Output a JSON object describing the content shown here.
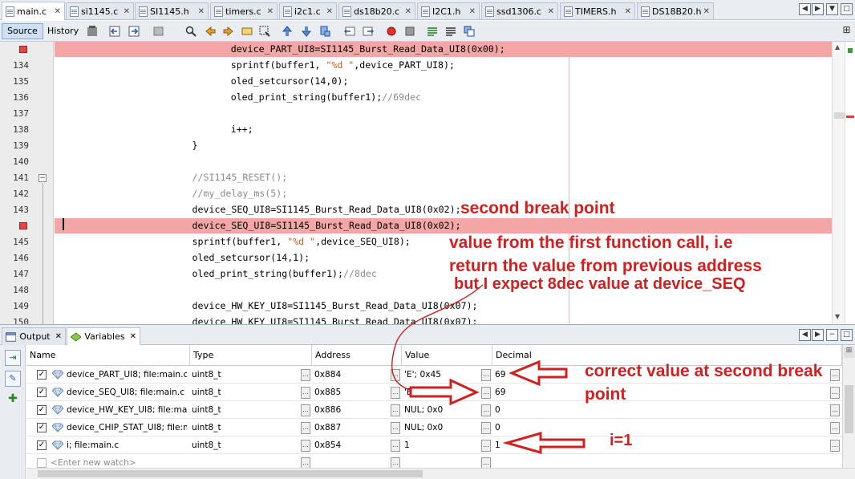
{
  "file_tabs": [
    {
      "name": "main.c",
      "active": true
    },
    {
      "name": "si1145.c",
      "active": false
    },
    {
      "name": "SI1145.h",
      "active": false
    },
    {
      "name": "timers.c",
      "active": false
    },
    {
      "name": "i2c1.c",
      "active": false
    },
    {
      "name": "ds18b20.c",
      "active": false
    },
    {
      "name": "I2C1.h",
      "active": false
    },
    {
      "name": "ssd1306.c",
      "active": false
    },
    {
      "name": "TIMERS.h",
      "active": false
    },
    {
      "name": "DS18B20.h",
      "active": false
    }
  ],
  "toolbar": {
    "source_label": "Source",
    "history_label": "History"
  },
  "editor": {
    "lines": [
      {
        "num": "",
        "breakpoint": true,
        "highlight": true,
        "indent": 9,
        "code": "device_PART_UI8=SI1145_Burst_Read_Data_UI8(0x00);"
      },
      {
        "num": "134",
        "indent": 9,
        "pre": "sprintf(buffer1, ",
        "str": "\"%d \"",
        "post": ",device_PART_UI8);"
      },
      {
        "num": "135",
        "indent": 9,
        "code": "oled_setcursor(14,0);"
      },
      {
        "num": "136",
        "indent": 9,
        "pre": "oled_print_string(buffer1);",
        "comment": "//69dec"
      },
      {
        "num": "137",
        "indent": 9,
        "code": ""
      },
      {
        "num": "138",
        "indent": 9,
        "code": "i++;"
      },
      {
        "num": "139",
        "indent": 7,
        "code": "}"
      },
      {
        "num": "140",
        "indent": 7,
        "code": ""
      },
      {
        "num": "141",
        "indent": 7,
        "comment": "//SI1145_RESET();"
      },
      {
        "num": "142",
        "indent": 7,
        "comment": "//my_delay_ms(5);"
      },
      {
        "num": "143",
        "indent": 7,
        "code": "device_SEQ_UI8=SI1145_Burst_Read_Data_UI8(0x02);"
      },
      {
        "num": "",
        "breakpoint": true,
        "highlight": true,
        "indent": 7,
        "code": "device_SEQ_UI8=SI1145_Burst_Read_Data_UI8(0x02);"
      },
      {
        "num": "145",
        "indent": 7,
        "pre": "sprintf(buffer1, ",
        "str": "\"%d \"",
        "post": ",device_SEQ_UI8);"
      },
      {
        "num": "146",
        "indent": 7,
        "code": "oled_setcursor(14,1);"
      },
      {
        "num": "147",
        "indent": 7,
        "pre": "oled_print_string(buffer1);",
        "comment": "//8dec"
      },
      {
        "num": "148",
        "indent": 7,
        "code": ""
      },
      {
        "num": "149",
        "indent": 7,
        "code": "device_HW_KEY_UI8=SI1145_Burst_Read_Data_UI8(0x07);"
      },
      {
        "num": "150",
        "indent": 7,
        "code": "device_HW_KEY_UI8=SI1145_Burst_Read_Data_UI8(0x07);"
      }
    ]
  },
  "panel": {
    "output_tab": "Output",
    "variables_tab": "Variables"
  },
  "variables": {
    "columns": [
      "Name",
      "Type",
      "Address",
      "Value",
      "Decimal"
    ],
    "rows": [
      {
        "name": "device_PART_UI8; file:main.c",
        "type": "uint8_t",
        "address": "0x884",
        "value": "'E'; 0x45",
        "decimal": "69"
      },
      {
        "name": "device_SEQ_UI8; file:main.c",
        "type": "uint8_t",
        "address": "0x885",
        "value": "'E'; 0x45",
        "decimal": "69"
      },
      {
        "name": "device_HW_KEY_UI8; file:main.c",
        "type": "uint8_t",
        "address": "0x886",
        "value": "NUL; 0x0",
        "decimal": "0"
      },
      {
        "name": "device_CHIP_STAT_UI8; file:main.c",
        "type": "uint8_t",
        "address": "0x887",
        "value": "NUL; 0x0",
        "decimal": "0"
      },
      {
        "name": "i; file:main.c",
        "type": "uint8_t",
        "address": "0x854",
        "value": "1",
        "decimal": "1"
      }
    ],
    "new_watch_placeholder": "<Enter new watch>"
  },
  "annotations": {
    "second_break_point": "second break point",
    "value_line1": "value from the first function call, i.e",
    "value_line2": "return the value from previous address",
    "value_line3": "but I expect 8dec value at device_SEQ",
    "correct_line1": "correct value at second break",
    "correct_line2": "point",
    "i_equals": "i=1"
  },
  "colors": {
    "breakpoint_line": "#f4a6a6",
    "annotation": "#d02020",
    "toolbar": "#e9edf2"
  }
}
